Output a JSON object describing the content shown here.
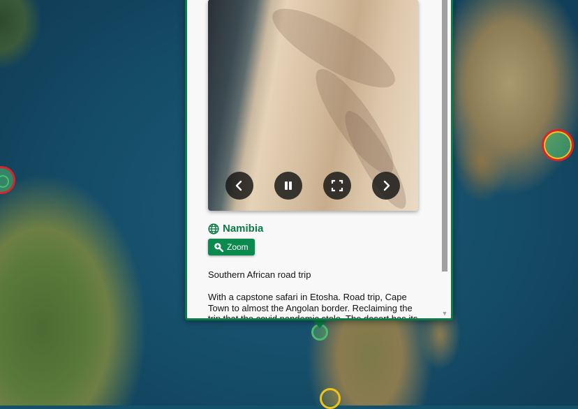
{
  "popup": {
    "title": "Namibia",
    "zoom_label": "Zoom",
    "subtitle": "Southern African road trip",
    "description": "With a capstone safari in Etosha. Road trip, Cape Town to almost the Angolan border. Reclaiming the trip that the covid pandemic stole. The desert has its"
  },
  "colors": {
    "accent": "#0b7a46",
    "button": "#0b8a4e",
    "marker_red": "#d9232d",
    "marker_yellow": "#f2c318",
    "marker_green": "#4cbb6c"
  },
  "icons": [
    "globe-icon",
    "zoom-in-icon",
    "chevron-left-icon",
    "pause-icon",
    "fullscreen-icon",
    "chevron-right-icon"
  ]
}
